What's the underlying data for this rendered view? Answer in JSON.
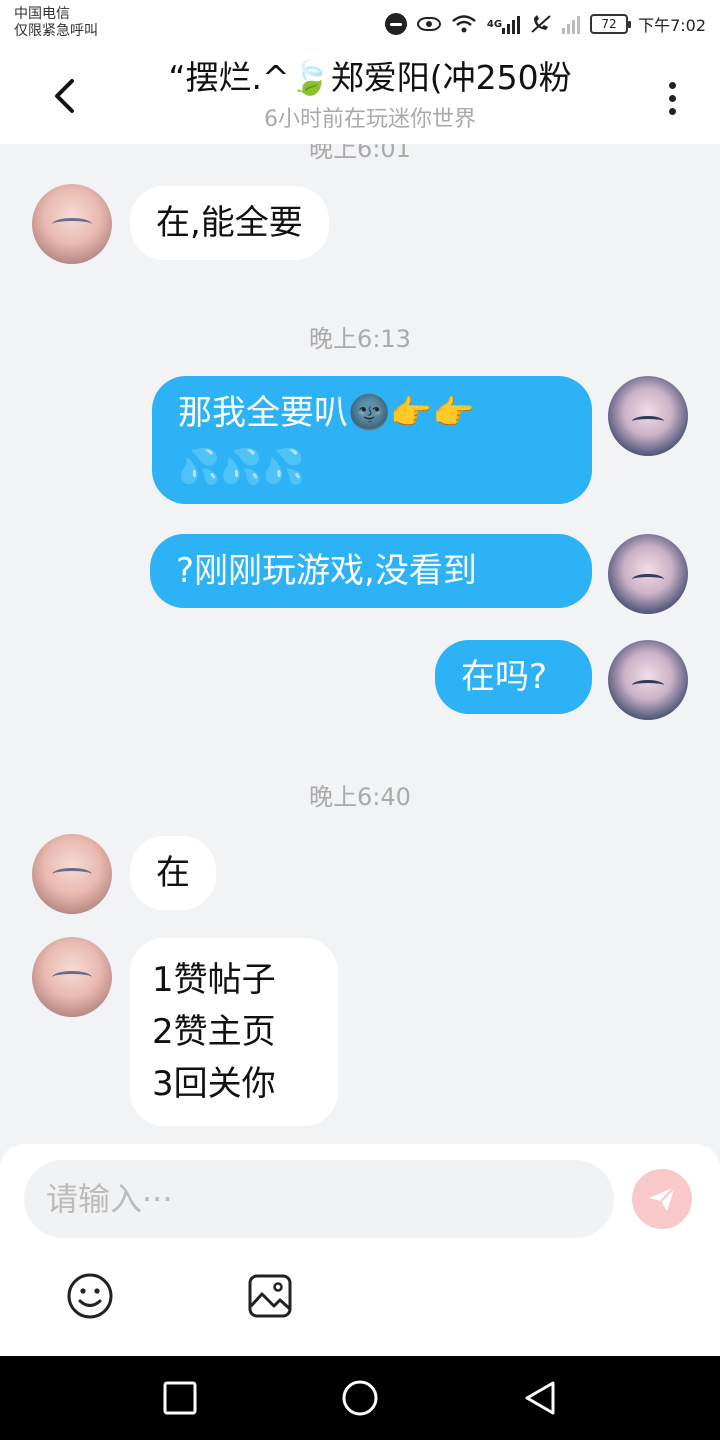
{
  "status_bar": {
    "carrier_line1": "中国电信",
    "carrier_line2": "仅限紧急呼叫",
    "network_label": "4G",
    "battery_level": "72",
    "time": "下午7:02"
  },
  "header": {
    "title": "“摆烂.^🍃郑爱阳(冲250粉",
    "subtitle": "6小时前在玩迷你世界"
  },
  "messages": {
    "ts0": "晚上6:01",
    "m1": "在,能全要",
    "ts1": "晚上6:13",
    "m2_line1": "那我全要叭🌚👉👉",
    "m2_line2": "💦💦💦",
    "m3": "?刚刚玩游戏,没看到",
    "m4": "在吗?",
    "ts2": "晚上6:40",
    "m5": "在",
    "m6_line1": "1赞帖子",
    "m6_line2": "2赞主页",
    "m6_line3": "3回关你"
  },
  "input": {
    "placeholder": "请输入···"
  },
  "colors": {
    "outgoing_bubble": "#2cb2f5",
    "incoming_bubble": "#ffffff",
    "send_button": "#f9c9c9",
    "chat_background": "#f2f3f5"
  },
  "icons": {
    "back": "chevron-left-icon",
    "more": "more-vertical-icon",
    "send": "paper-plane-icon",
    "emoji": "smiley-icon",
    "image": "image-icon",
    "nav_recents": "square-icon",
    "nav_home": "circle-icon",
    "nav_back": "triangle-icon"
  }
}
